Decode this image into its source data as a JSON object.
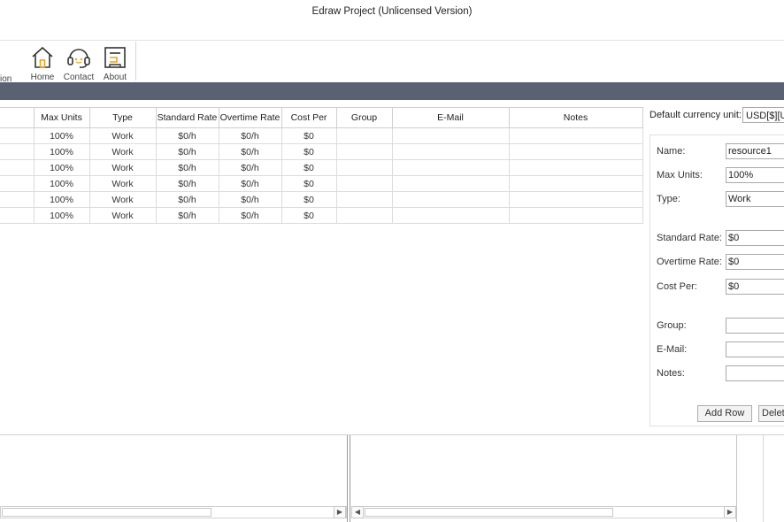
{
  "window": {
    "title": "Edraw Project (Unlicensed Version)"
  },
  "ribbon": {
    "cut_label": "ion",
    "buttons": [
      {
        "label": "Home",
        "icon": "home-icon"
      },
      {
        "label": "Contact",
        "icon": "headset-icon"
      },
      {
        "label": "About",
        "icon": "about-icon"
      }
    ]
  },
  "grid": {
    "columns": [
      "",
      "Max Units",
      "Type",
      "Standard Rate",
      "Overtime Rate",
      "Cost Per",
      "Group",
      "E-Mail",
      "Notes"
    ],
    "rows": [
      [
        "",
        "100%",
        "Work",
        "$0/h",
        "$0/h",
        "$0",
        "",
        "",
        ""
      ],
      [
        "",
        "100%",
        "Work",
        "$0/h",
        "$0/h",
        "$0",
        "",
        "",
        ""
      ],
      [
        "",
        "100%",
        "Work",
        "$0/h",
        "$0/h",
        "$0",
        "",
        "",
        ""
      ],
      [
        "",
        "100%",
        "Work",
        "$0/h",
        "$0/h",
        "$0",
        "",
        "",
        ""
      ],
      [
        "",
        "100%",
        "Work",
        "$0/h",
        "$0/h",
        "$0",
        "",
        "",
        ""
      ],
      [
        "",
        "100%",
        "Work",
        "$0/h",
        "$0/h",
        "$0",
        "",
        "",
        ""
      ]
    ]
  },
  "currency": {
    "label": "Default currency unit:",
    "value": "USD[$][U"
  },
  "form": {
    "name_label": "Name:",
    "name_value": "resource1",
    "max_units_label": "Max Units:",
    "max_units_value": "100%",
    "type_label": "Type:",
    "type_value": "Work",
    "standard_rate_label": "Standard Rate:",
    "standard_rate_value": "$0",
    "overtime_rate_label": "Overtime Rate:",
    "overtime_rate_value": "$0",
    "cost_per_label": "Cost Per:",
    "cost_per_value": "$0",
    "group_label": "Group:",
    "group_value": "",
    "email_label": "E-Mail:",
    "email_value": "",
    "notes_label": "Notes:",
    "notes_value": "",
    "add_row_label": "Add Row",
    "delete_label": "Delet"
  },
  "scroll": {
    "left": "◀",
    "right": "▶"
  },
  "colors": {
    "band": "#5a6173",
    "accent": "#e8a21e"
  }
}
